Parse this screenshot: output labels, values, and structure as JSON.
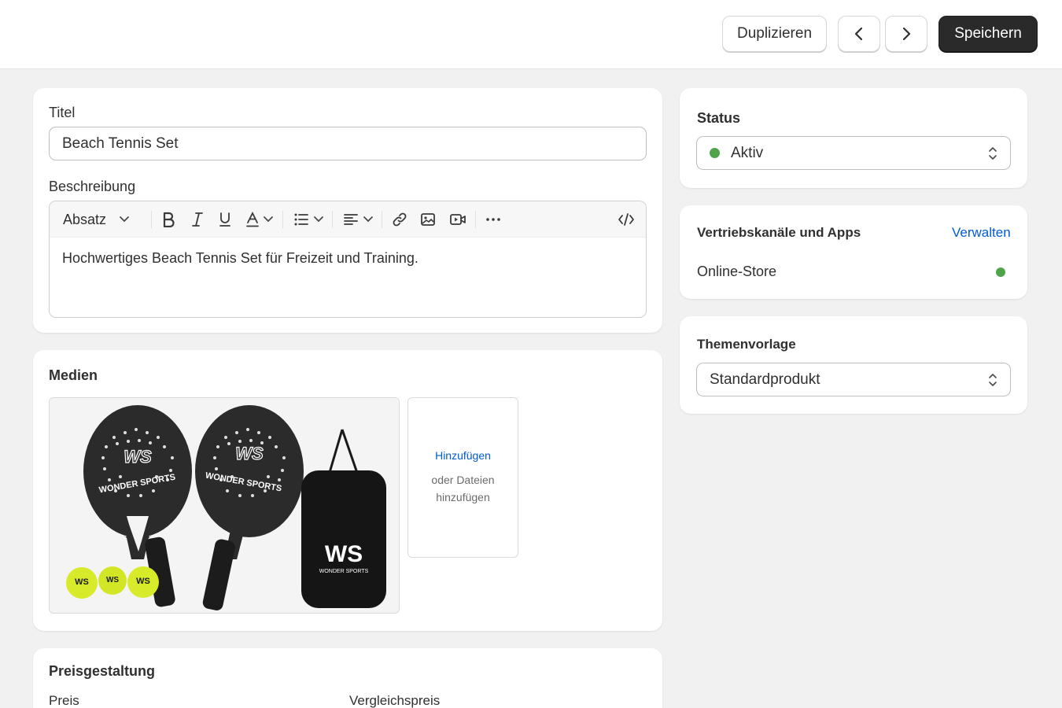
{
  "header": {
    "duplicate_label": "Duplizieren",
    "save_label": "Speichern"
  },
  "product": {
    "title_label": "Titel",
    "title_value": "Beach Tennis Set",
    "description_label": "Beschreibung",
    "paragraph_style": "Absatz",
    "description_text": "Hochwertiges Beach Tennis Set für Freizeit und Training."
  },
  "media": {
    "heading": "Medien",
    "add_label": "Hinzufügen",
    "add_sub": "oder Dateien hinzufügen",
    "image_brand": "WONDER SPORTS",
    "image_logo": "WS"
  },
  "pricing": {
    "heading": "Preisgestaltung",
    "price_label": "Preis",
    "compare_label": "Vergleichspreis"
  },
  "status": {
    "heading": "Status",
    "value": "Aktiv",
    "color": "#4fa44a"
  },
  "channels": {
    "heading": "Vertriebskanäle und Apps",
    "manage_label": "Verwalten",
    "items": [
      {
        "label": "Online-Store",
        "status_color": "#4fa44a"
      }
    ]
  },
  "template": {
    "heading": "Themenvorlage",
    "value": "Standardprodukt"
  },
  "icons": {
    "prev": "chevron-left-icon",
    "next": "chevron-right-icon",
    "bold": "bold-icon",
    "italic": "italic-icon",
    "underline": "underline-icon",
    "text_color": "text-color-icon",
    "list": "list-icon",
    "align": "align-icon",
    "link": "link-icon",
    "image": "image-icon",
    "video": "video-icon",
    "more": "more-icon",
    "code": "code-icon"
  }
}
